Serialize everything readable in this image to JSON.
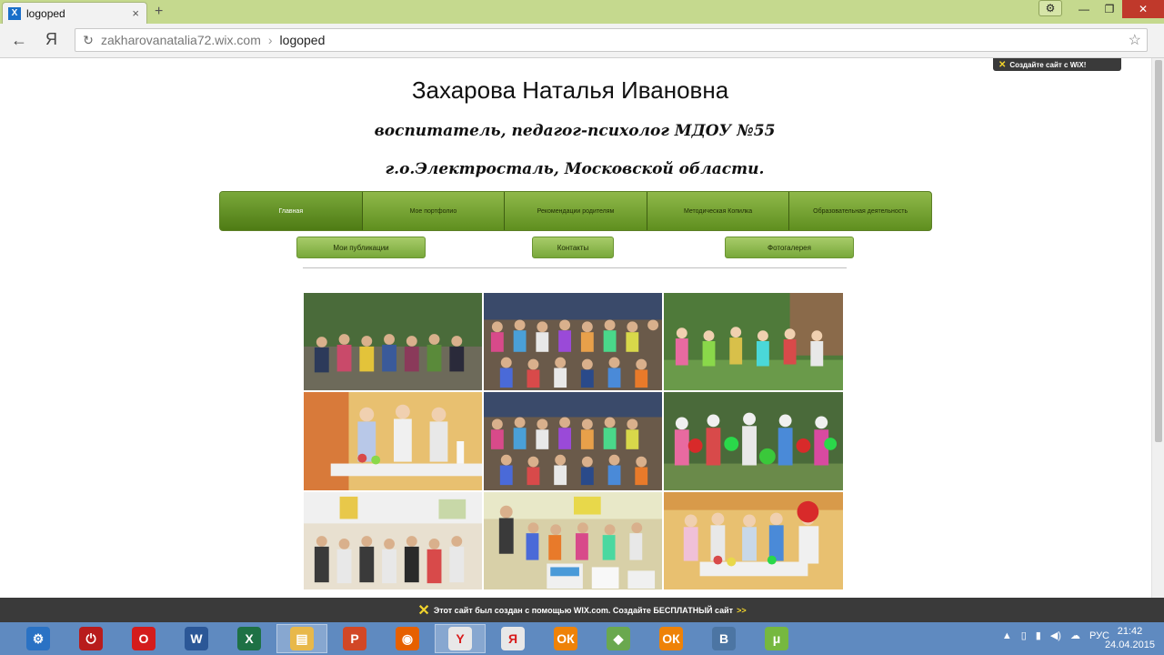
{
  "browser": {
    "tab_title": "logoped",
    "tab_favicon": "wix-x-icon",
    "new_tab_symbol": "+",
    "address_domain": "zakharovanatalia72.wix.com",
    "address_separator": "›",
    "address_path": "logoped",
    "yandex_letter": "Я"
  },
  "page": {
    "wix_badge": "Создайте сайт с WiX!",
    "title": "Захарова Наталья Ивановна",
    "subtitle1": "воспитатель, педагог-психолог МДОУ №55",
    "subtitle2": "г.о.Электросталь, Московской области.",
    "menu": [
      {
        "label": "Главная",
        "active": true
      },
      {
        "label": "Мое портфолио",
        "active": false
      },
      {
        "label": "Рекомендации родителям",
        "active": false
      },
      {
        "label": "Методическая Копилка",
        "active": false
      },
      {
        "label": "Образовательная деятельность",
        "active": false
      }
    ],
    "sub_buttons": [
      "Мои публикации",
      "Контакты",
      "Фотогалерея"
    ],
    "photos": [
      {
        "name": "photo-children-outdoor-group"
      },
      {
        "name": "photo-children-indoor-group"
      },
      {
        "name": "photo-children-outdoor-play"
      },
      {
        "name": "photo-children-table-activity"
      },
      {
        "name": "photo-children-group-indoor-2"
      },
      {
        "name": "photo-children-balloons"
      },
      {
        "name": "photo-children-classroom"
      },
      {
        "name": "photo-children-posters"
      },
      {
        "name": "photo-children-clown-table"
      }
    ],
    "footer_banner": "Этот сайт был создан с помощью WIX.com. Создайте БЕСПЛАТНЫЙ сайт",
    "footer_arrows": ">>"
  },
  "taskbar": {
    "tray_lang": "РУС",
    "time": "21:42",
    "date": "24.04.2015",
    "apps": [
      {
        "name": "control-panel-icon",
        "color": "#2a72c4",
        "glyph": "⚙"
      },
      {
        "name": "power-icon",
        "color": "#b81c1c",
        "glyph": "⏻"
      },
      {
        "name": "opera-icon",
        "color": "#d41c1c",
        "glyph": "O"
      },
      {
        "name": "word-icon",
        "color": "#2b5797",
        "glyph": "W"
      },
      {
        "name": "excel-icon",
        "color": "#1e7145",
        "glyph": "X"
      },
      {
        "name": "explorer-icon",
        "color": "#e8b84a",
        "glyph": "▤"
      },
      {
        "name": "powerpoint-icon",
        "color": "#d24726",
        "glyph": "P"
      },
      {
        "name": "firefox-icon",
        "color": "#e66000",
        "glyph": "◉"
      },
      {
        "name": "yandex-browser-icon",
        "color": "#e8e8e8",
        "glyph": "Y"
      },
      {
        "name": "yandex-icon",
        "color": "#e8e8e8",
        "glyph": "Я"
      },
      {
        "name": "odnoklassniki-icon",
        "color": "#ee8208",
        "glyph": "ОК"
      },
      {
        "name": "android-icon",
        "color": "#6aa84f",
        "glyph": "◆"
      },
      {
        "name": "odnoklassniki-2-icon",
        "color": "#ee8208",
        "glyph": "ОК"
      },
      {
        "name": "vk-icon",
        "color": "#4c75a3",
        "glyph": "B"
      },
      {
        "name": "utorrent-icon",
        "color": "#76b83f",
        "glyph": "μ"
      }
    ]
  },
  "colors": {
    "menu_green": "#6e9e2c",
    "titlebar_green": "#c5d98e",
    "wix_dark": "#3a3a3a",
    "taskbar_blue": "#5f8ac0"
  }
}
